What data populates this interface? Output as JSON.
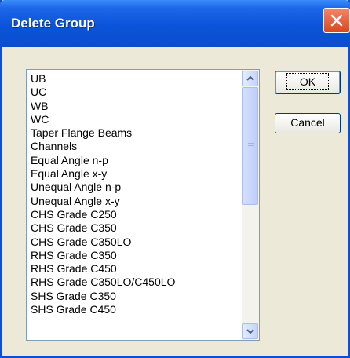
{
  "dialog": {
    "title": "Delete Group",
    "list_items": [
      "UB",
      "UC",
      "WB",
      "WC",
      "Taper Flange Beams",
      "Channels",
      "Equal Angle n-p",
      "Equal Angle x-y",
      "Unequal Angle n-p",
      "Unequal Angle x-y",
      "CHS Grade C250",
      "CHS Grade C350",
      "CHS Grade C350LO",
      "RHS Grade C350",
      "RHS Grade C450",
      "RHS Grade C350LO/C450LO",
      "SHS Grade C350",
      "SHS Grade C450"
    ],
    "buttons": {
      "ok": "OK",
      "cancel": "Cancel"
    }
  },
  "icons": {
    "close": "close-icon",
    "scroll_up": "scroll-up-arrow-icon",
    "scroll_down": "scroll-down-arrow-icon"
  },
  "colors": {
    "title_bar": "#0a54da",
    "close_button": "#d8481e",
    "dialog_bg": "#ece9d8"
  }
}
